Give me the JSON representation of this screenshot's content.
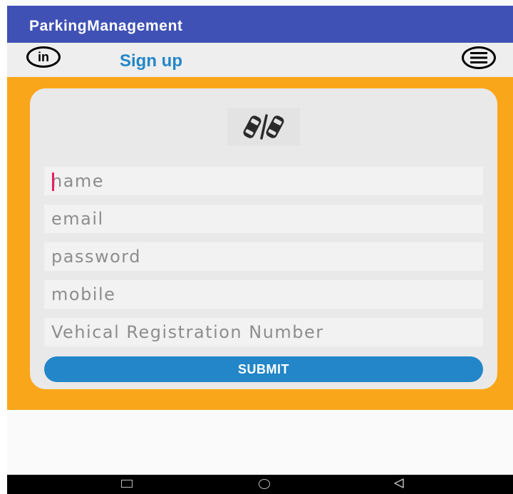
{
  "app": {
    "title": "ParkingManagement"
  },
  "tabbar": {
    "badge_text": "in",
    "active_tab": "Sign up",
    "menu_icon": "hamburger-menu-icon"
  },
  "logo": {
    "icon": "two-cars-icon"
  },
  "form": {
    "name_placeholder": "name",
    "email_placeholder": "email",
    "password_placeholder": "password",
    "mobile_placeholder": "mobile",
    "vehicle_placeholder": "Vehical Registration Number",
    "submit_label": "SUBMIT"
  },
  "navbar": {
    "recents_icon": "recents-square-icon",
    "home_icon": "home-circle-icon",
    "back_icon": "back-triangle-icon"
  },
  "colors": {
    "appbar": "#3f51b5",
    "accent_blue": "#2386c8",
    "panel_orange": "#faa61a",
    "cursor_pink": "#e91e63"
  }
}
